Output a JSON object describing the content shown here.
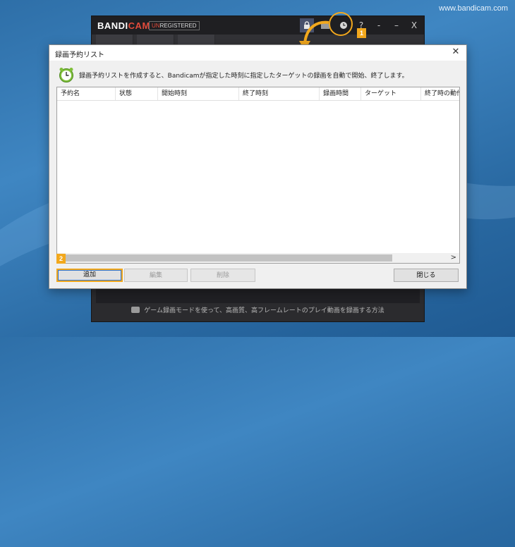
{
  "watermark": "www.bandicam.com",
  "bandicam": {
    "logo_main": "BANDI",
    "logo_cam": "CAM",
    "unregistered_un": "UN",
    "unregistered_rest": "REGISTERED",
    "titlebar_icons": [
      "lock-icon",
      "folder-icon",
      "clock-icon",
      "help-icon",
      "minimize-icon",
      "dash-icon",
      "close-icon"
    ],
    "help_glyph": "?",
    "min_glyph": "-",
    "dash_glyph": "–",
    "close_glyph": "X",
    "tip_text": "ゲーム録画モードを使って、高画質、高フレームレートのプレイ動画を録画する方法"
  },
  "callouts": {
    "badge1": "1",
    "badge2": "2"
  },
  "dialog": {
    "title": "録画予約リスト",
    "close_glyph": "✕",
    "info_text": "録画予約リストを作成すると、Bandicamが指定した時刻に指定したターゲットの録画を自動で開始、終了します。",
    "columns": [
      "予約名",
      "状態",
      "開始時刻",
      "終了時刻",
      "録画時間",
      "ターゲット",
      "終了時の動作"
    ],
    "rows": [],
    "scroll_right_glyph": ">",
    "buttons": {
      "add": "追加",
      "edit": "編集",
      "delete": "削除",
      "close": "閉じる"
    }
  },
  "colors": {
    "accent_orange": "#f2a81d",
    "bandicam_red": "#e24b3b",
    "focus_blue": "#2f74d0"
  }
}
